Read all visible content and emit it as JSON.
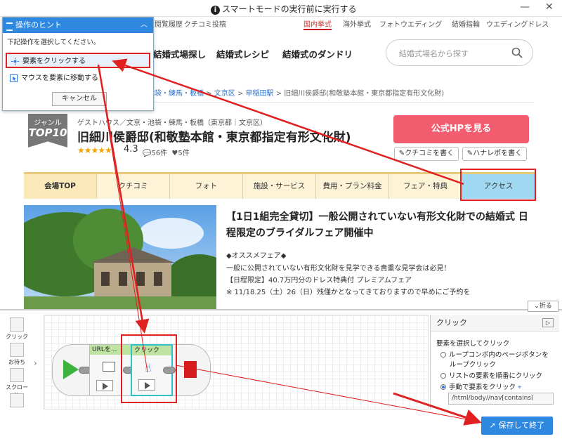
{
  "titlebar": {
    "text": "スマートモードの実行前に実行する",
    "info_icon": "i",
    "minimize": "—",
    "close": "✕"
  },
  "topnav": {
    "items": [
      "閲覧履歴",
      "クチコミ投稿"
    ],
    "regions": [
      "国内挙式",
      "海外挙式",
      "フォトウエディング",
      "結婚指輪",
      "ウエディングドレス"
    ]
  },
  "mainnav": {
    "items": [
      "結婚式場探し",
      "結婚式レシピ",
      "結婚式のダンドリ"
    ]
  },
  "search": {
    "placeholder": "結婚式場名から探す"
  },
  "breadcrumb": {
    "prefix": "京・池袋・練馬・板橋",
    "sep": ">",
    "ward": "文京区",
    "station": "早稲田駅",
    "current": "旧細川侯爵邸(和敬塾本館・東京都指定有形文化財)"
  },
  "venue": {
    "badge_genre": "ジャンル",
    "badge_top": "TOP10",
    "subtitle": "ゲストハウス／文京・池袋・練馬・板橋（東京都｜文京区）",
    "name": "旧細川侯爵邸(和敬塾本館・東京都指定有形文化財)",
    "stars": "★★★★★",
    "rating": "4.3",
    "reviews": "56件",
    "visits": "5件",
    "official_btn": "公式HPを見る",
    "review_btn": "クチコミを書く",
    "hanarepo_btn": "ハナレポを書く"
  },
  "tabs": [
    "会場TOP",
    "クチコミ",
    "フォト",
    "施設・サービス",
    "費用・プラン料金",
    "フェア・特典",
    "アクセス"
  ],
  "feature": {
    "title": "【1日1組完全貸切】一般公開されていない有形文化財での結婚式 日程限定のブライダルフェア開催中",
    "lines": [
      "◆オススメフェア◆",
      "一般に公開されていない有形文化財を見学できる貴重な見学会は必見！",
      "【日程限定】40.7万円分のドレス特典付 プレミアムフェア",
      "※ 11/18.25（土）26（日）残僅かとなってきておりますので早めにご予約を"
    ]
  },
  "fold_btn": "折る",
  "tools": [
    "クリック",
    "お待ち",
    "スクロール"
  ],
  "flow": {
    "node1": "URLを...",
    "node2": "クリック"
  },
  "rpanel": {
    "title": "クリック",
    "heading": "要素を選択してクリック",
    "options": [
      "ループコンボ内のページボタンを",
      "ループクリック",
      "リストの要素を順番にクリック",
      "手動で要素をクリック"
    ],
    "xpath": "/html/body//nav[contains("
  },
  "save_btn": "保存して終了",
  "hint": {
    "title": "操作のヒント",
    "desc": "下記操作を選択してください。",
    "opt1": "要素をクリックする",
    "opt2": "マウスを要素に移動する",
    "cancel": "キャンセル"
  },
  "colors": {
    "accent": "#2f88e0",
    "highlight": "#e02020",
    "pink": "#f25c6e",
    "access_tab": "#9fd8f0"
  }
}
